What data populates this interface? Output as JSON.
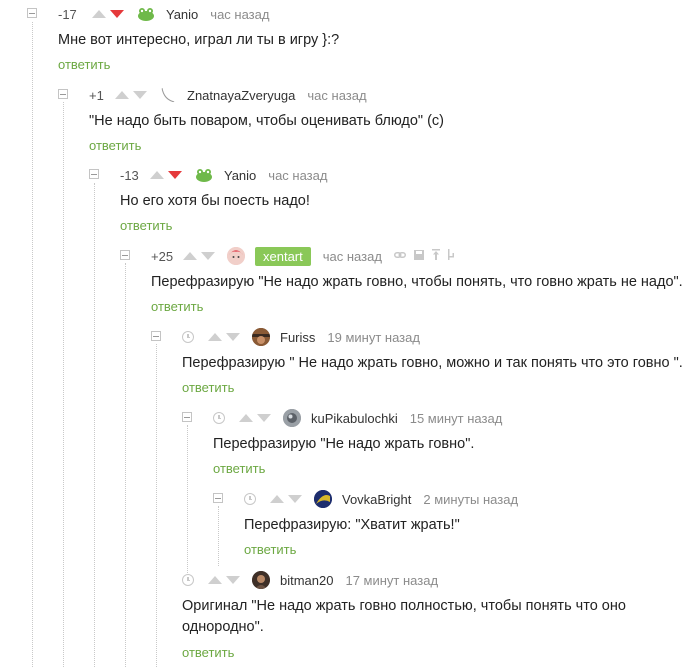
{
  "comments": [
    {
      "rating": "-17",
      "author": "Yanio",
      "time": "час назад",
      "text": "Мне вот интересно, играл ли ты в игру }:?",
      "reply": "ответить"
    },
    {
      "rating": "+1",
      "author": "ZnatnayaZveryuga",
      "time": "час назад",
      "text": "\"Не надо быть поваром, чтобы оценивать блюдо\" (с)",
      "reply": "ответить"
    },
    {
      "rating": "-13",
      "author": "Yanio",
      "time": "час назад",
      "text": "Но его хотя бы поесть надо!",
      "reply": "ответить"
    },
    {
      "rating": "+25",
      "author": "xentart",
      "time": "час назад",
      "text": "Перефразирую \"Не надо жрать говно, чтобы понять, что говно жрать не надо\".",
      "reply": "ответить"
    },
    {
      "author": "Furiss",
      "time": "19 минут назад",
      "text": "Перефразирую \" Не надо жрать говно, можно и так понять что это говно \".",
      "reply": "ответить"
    },
    {
      "author": "kuPikabulochki",
      "time": "15 минут назад",
      "text": "Перефразирую \"Не надо жрать говно\".",
      "reply": "ответить"
    },
    {
      "author": "VovkaBright",
      "time": "2 минуты назад",
      "text": "Перефразирую: \"Хватит жрать!\"",
      "reply": "ответить"
    },
    {
      "author": "bitman20",
      "time": "17 минут назад",
      "text_line1": "Оригинал \"Не надо жрать говно полностью, чтобы понять что оно",
      "text_line2": "однородно\".",
      "reply": "ответить"
    }
  ],
  "icons": {
    "downvoted": "arrow-down-red",
    "hidden_rating": "clock-icon",
    "tools": [
      "link-icon",
      "save-icon",
      "pin-icon",
      "branch-icon"
    ]
  },
  "colors": {
    "reply_link": "#6ca842",
    "downvote_active": "#e5393b",
    "author_badge": "#8ac858"
  }
}
